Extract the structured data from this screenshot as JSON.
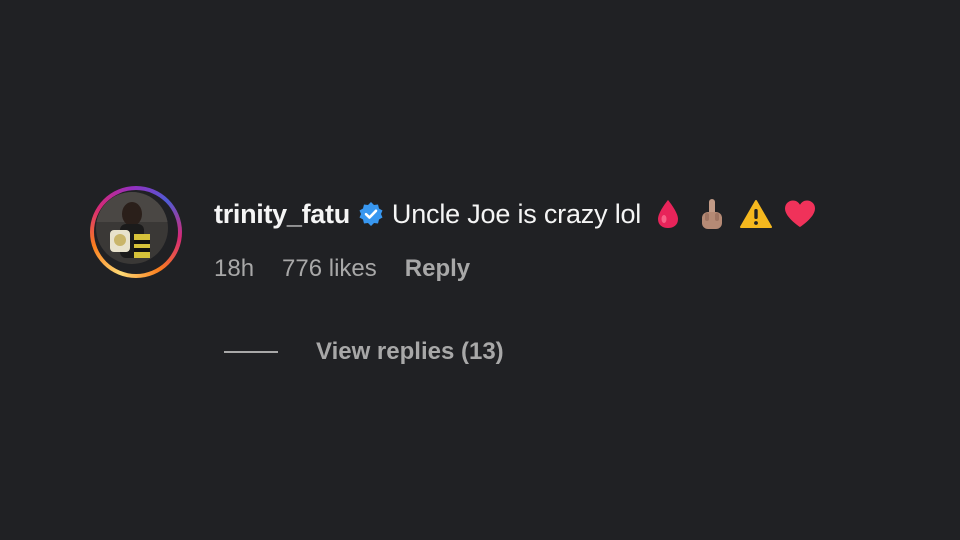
{
  "comment": {
    "avatar_icon": "user-avatar",
    "username": "trinity_fatu",
    "verified_icon": "verified-badge-icon",
    "text": "Uncle Joe is crazy lol",
    "emojis": [
      "drop-of-blood-icon",
      "index-pointing-up-icon",
      "warning-icon",
      "red-heart-icon"
    ],
    "time": "18h",
    "likes": "776 likes",
    "reply_label": "Reply",
    "view_replies": "View replies (13)"
  },
  "colors": {
    "background": "#202124",
    "primary_text": "#f5f5f5",
    "secondary_text": "#a8a8a8",
    "verified_blue": "#3897f0"
  }
}
